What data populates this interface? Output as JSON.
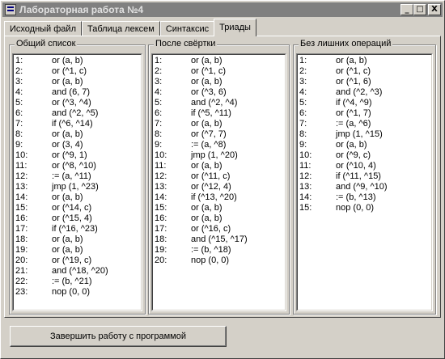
{
  "window": {
    "title": "Лабораторная работа №4",
    "buttons": {
      "minimize": "_",
      "maximize": "□",
      "close": "X"
    }
  },
  "tabs": [
    {
      "label": "Исходный файл",
      "active": false
    },
    {
      "label": "Таблица лексем",
      "active": false
    },
    {
      "label": "Синтаксис",
      "active": false
    },
    {
      "label": "Триады",
      "active": true
    }
  ],
  "groups": [
    {
      "caption": "Общий список",
      "rows": [
        [
          "1:",
          "or (a, b)"
        ],
        [
          "2:",
          "or (^1, c)"
        ],
        [
          "3:",
          "or (a, b)"
        ],
        [
          "4:",
          "and (6, 7)"
        ],
        [
          "5:",
          "or (^3, ^4)"
        ],
        [
          "6:",
          "and (^2, ^5)"
        ],
        [
          "7:",
          "if (^6, ^14)"
        ],
        [
          "8:",
          "or (a, b)"
        ],
        [
          "9:",
          "or (3, 4)"
        ],
        [
          "10:",
          "or (^9, 1)"
        ],
        [
          "11:",
          "or (^8, ^10)"
        ],
        [
          "12:",
          ":= (a, ^11)"
        ],
        [
          "13:",
          "jmp (1, ^23)"
        ],
        [
          "14:",
          "or (a, b)"
        ],
        [
          "15:",
          "or (^14, c)"
        ],
        [
          "16:",
          "or (^15, 4)"
        ],
        [
          "17:",
          "if (^16, ^23)"
        ],
        [
          "18:",
          "or (a, b)"
        ],
        [
          "19:",
          "or (a, b)"
        ],
        [
          "20:",
          "or (^19, c)"
        ],
        [
          "21:",
          "and (^18, ^20)"
        ],
        [
          "22:",
          ":= (b, ^21)"
        ],
        [
          "23:",
          "nop (0, 0)"
        ]
      ]
    },
    {
      "caption": "После свёртки",
      "rows": [
        [
          "1:",
          "or (a, b)"
        ],
        [
          "2:",
          "or (^1, c)"
        ],
        [
          "3:",
          "or (a, b)"
        ],
        [
          "4:",
          "or (^3, 6)"
        ],
        [
          "5:",
          "and (^2, ^4)"
        ],
        [
          "6:",
          "if (^5, ^11)"
        ],
        [
          "7:",
          "or (a, b)"
        ],
        [
          "8:",
          "or (^7, 7)"
        ],
        [
          "9:",
          ":= (a, ^8)"
        ],
        [
          "10:",
          "jmp (1, ^20)"
        ],
        [
          "11:",
          "or (a, b)"
        ],
        [
          "12:",
          "or (^11, c)"
        ],
        [
          "13:",
          "or (^12, 4)"
        ],
        [
          "14:",
          "if (^13, ^20)"
        ],
        [
          "15:",
          "or (a, b)"
        ],
        [
          "16:",
          "or (a, b)"
        ],
        [
          "17:",
          "or (^16, c)"
        ],
        [
          "18:",
          "and (^15, ^17)"
        ],
        [
          "19:",
          ":= (b, ^18)"
        ],
        [
          "20:",
          "nop (0, 0)"
        ]
      ]
    },
    {
      "caption": "Без лишних операций",
      "rows": [
        [
          "1:",
          "or (a, b)"
        ],
        [
          "2:",
          "or (^1, c)"
        ],
        [
          "3:",
          "or (^1, 6)"
        ],
        [
          "4:",
          "and (^2, ^3)"
        ],
        [
          "5:",
          "if (^4, ^9)"
        ],
        [
          "6:",
          "or (^1, 7)"
        ],
        [
          "7:",
          ":= (a, ^6)"
        ],
        [
          "8:",
          "jmp (1, ^15)"
        ],
        [
          "9:",
          "or (a, b)"
        ],
        [
          "10:",
          "or (^9, c)"
        ],
        [
          "11:",
          "or (^10, 4)"
        ],
        [
          "12:",
          "if (^11, ^15)"
        ],
        [
          "13:",
          "and (^9, ^10)"
        ],
        [
          "14:",
          ":= (b, ^13)"
        ],
        [
          "15:",
          "nop (0, 0)"
        ]
      ]
    }
  ],
  "exit_button": "Завершить работу с программой"
}
